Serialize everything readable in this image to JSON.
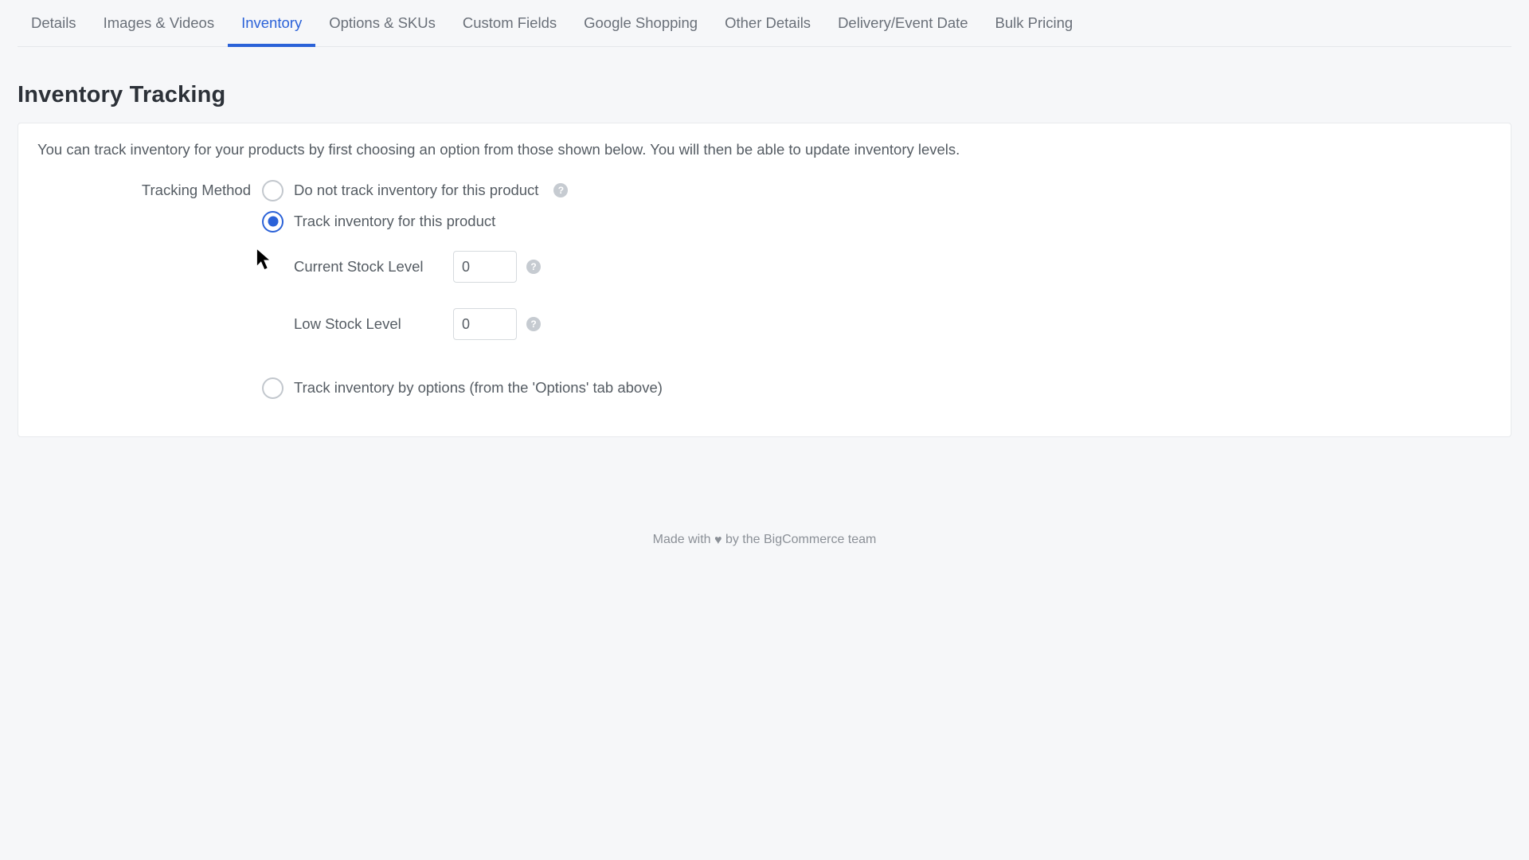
{
  "tabs": [
    {
      "label": "Details",
      "active": false
    },
    {
      "label": "Images & Videos",
      "active": false
    },
    {
      "label": "Inventory",
      "active": true
    },
    {
      "label": "Options & SKUs",
      "active": false
    },
    {
      "label": "Custom Fields",
      "active": false
    },
    {
      "label": "Google Shopping",
      "active": false
    },
    {
      "label": "Other Details",
      "active": false
    },
    {
      "label": "Delivery/Event Date",
      "active": false
    },
    {
      "label": "Bulk Pricing",
      "active": false
    }
  ],
  "section": {
    "title": "Inventory Tracking"
  },
  "panel": {
    "description": "You can track inventory for your products by first choosing an option from those shown below. You will then be able to update inventory levels.",
    "side_label": "Tracking Method",
    "options": {
      "none": "Do not track inventory for this product",
      "product": "Track inventory for this product",
      "by_options": "Track inventory by options (from the 'Options' tab above)"
    },
    "fields": {
      "current_stock": {
        "label": "Current Stock Level",
        "value": "0"
      },
      "low_stock": {
        "label": "Low Stock Level",
        "value": "0"
      }
    }
  },
  "footer": {
    "prefix": "Made with ",
    "suffix": " by the BigCommerce team"
  }
}
